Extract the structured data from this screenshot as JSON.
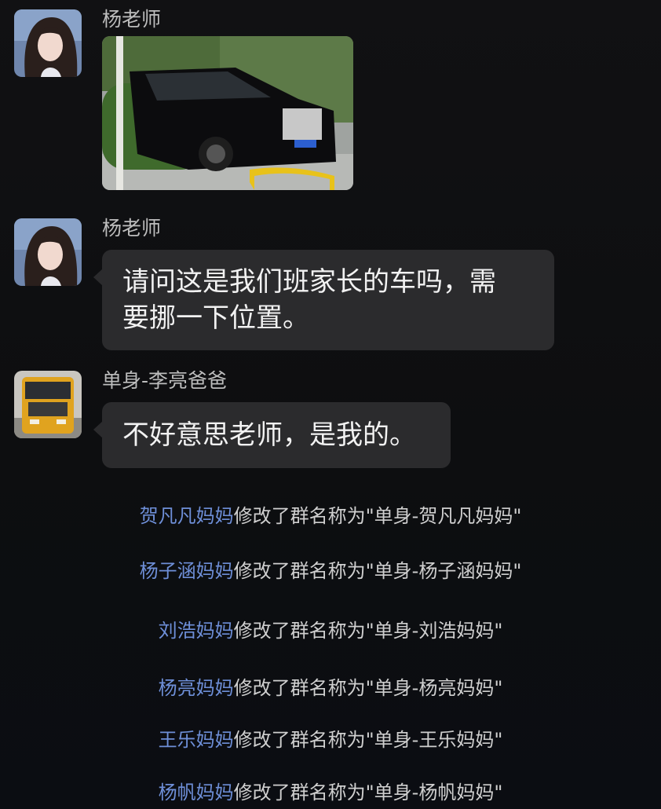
{
  "messages": [
    {
      "sender": "杨老师",
      "type": "image",
      "image_alt": "black-luxury-car-photo"
    },
    {
      "sender": "杨老师",
      "type": "text",
      "line1": "请问这是我们班家长的车吗，需",
      "line2": "要挪一下位置。"
    },
    {
      "sender": "单身-李亮爸爸",
      "type": "text",
      "line1": "不好意思老师，是我的。"
    }
  ],
  "system_notices": [
    {
      "who": "贺凡凡妈妈",
      "action": "修改了群名称为\"单身-贺凡凡妈妈\""
    },
    {
      "who": "杨子涵妈妈",
      "action": "修改了群名称为\"单身-杨子涵妈妈\""
    },
    {
      "who": "刘浩妈妈",
      "action": "修改了群名称为\"单身-刘浩妈妈\""
    },
    {
      "who": "杨亮妈妈",
      "action": "修改了群名称为\"单身-杨亮妈妈\""
    },
    {
      "who": "王乐妈妈",
      "action": "修改了群名称为\"单身-王乐妈妈\""
    },
    {
      "who": "杨帆妈妈",
      "action": "修改了群名称为\"单身-杨帆妈妈\""
    }
  ],
  "colors": {
    "background": "#0f0f10",
    "bubble": "#2b2b2d",
    "name_link": "#6e8fd8"
  }
}
